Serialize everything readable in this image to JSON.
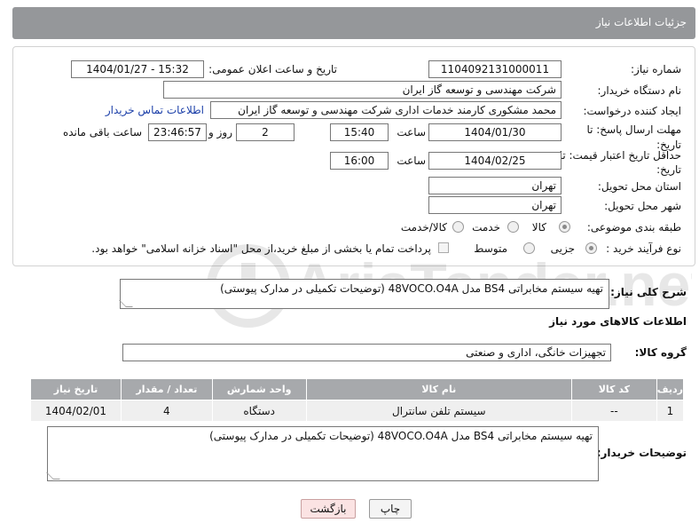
{
  "header": {
    "title": "جزئیات اطلاعات نیاز"
  },
  "form": {
    "need_number_label": "شماره نیاز:",
    "need_number": "1104092131000011",
    "announce_label": "تاریخ و ساعت اعلان عمومی:",
    "announce_value": "1404/01/27 - 15:32",
    "buyer_org_label": "نام دستگاه خریدار:",
    "buyer_org": "شرکت مهندسی و توسعه گاز ایران",
    "creator_label": "ایجاد کننده درخواست:",
    "creator": "محمد مشکوری کارمند خدمات اداری شرکت مهندسی و توسعه گاز ایران",
    "contact_link": "اطلاعات تماس خریدار",
    "deadline_label": "مهلت ارسال پاسخ: تا تاریخ:",
    "deadline_date": "1404/01/30",
    "time_label": "ساعت",
    "deadline_time": "15:40",
    "days_value": "2",
    "days_label": "روز و",
    "remaining_value": "23:46:57",
    "remaining_label": "ساعت باقی مانده",
    "price_valid_label": "حداقل تاریخ اعتبار قیمت: تا تاریخ:",
    "price_valid_date": "1404/02/25",
    "price_valid_time": "16:00",
    "province_label": "استان محل تحویل:",
    "province": "تهران",
    "city_label": "شهر محل تحویل:",
    "city": "تهران",
    "category_label": "طبقه بندی موضوعی:",
    "category_options": [
      "کالا",
      "خدمت",
      "کالا/خدمت"
    ],
    "process_label": "نوع فرآیند خرید :",
    "process_options": [
      "جزیی",
      "متوسط"
    ],
    "payment_note": "پرداخت تمام یا بخشی از مبلغ خرید،از محل \"اسناد خزانه اسلامی\" خواهد بود."
  },
  "summary": {
    "label": "شرح کلی نیاز:",
    "text": "تهیه سیستم مخابراتی BS4 مدل 48VOCO.O4A (توضیحات تکمیلی در مدارک پیوستی)"
  },
  "goods": {
    "section_title": "اطلاعات کالاهای مورد نیاز",
    "group_label": "گروه کالا:",
    "group_value": "تجهیزات خانگی، اداری و صنعتی",
    "columns": [
      "ردیف",
      "کد کالا",
      "نام کالا",
      "واحد شمارش",
      "تعداد / مقدار",
      "تاریخ نیاز"
    ],
    "rows": [
      [
        "1",
        "--",
        "سیستم تلفن سانترال",
        "دستگاه",
        "4",
        "1404/02/01"
      ]
    ]
  },
  "buyer_notes": {
    "label": "توضیحات خریدار:",
    "text": "تهیه سیستم مخابراتی BS4 مدل 48VOCO.O4A (توضیحات تکمیلی در مدارک پیوستی)"
  },
  "buttons": {
    "print": "چاپ",
    "back": "بازگشت"
  },
  "watermark": {
    "text": "AriaTender.net"
  },
  "colors": {
    "header_bg": "#95979a",
    "table_header_bg": "#a7a9ac",
    "link": "#1a3ea8",
    "back_button_bg": "#fbe3e3"
  }
}
